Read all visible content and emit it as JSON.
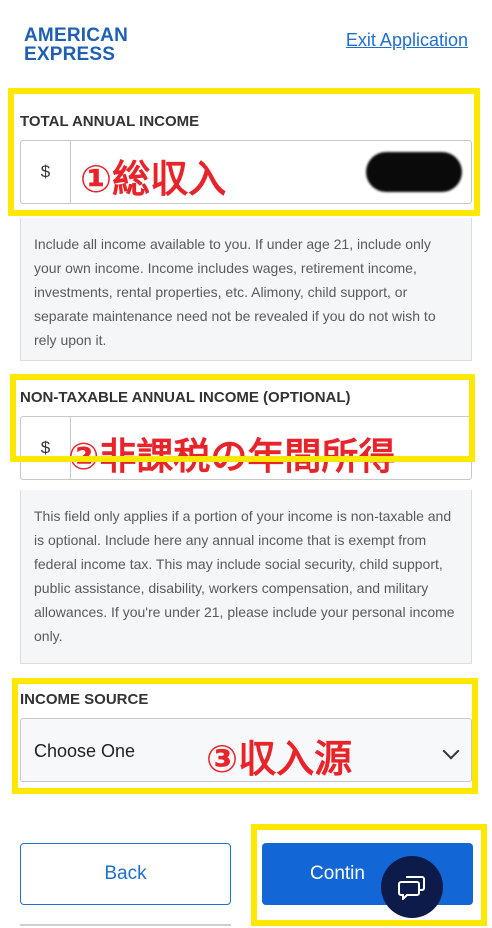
{
  "header": {
    "logo_line1": "AMERICAN",
    "logo_line2": "EXPRESS",
    "exit_label": "Exit Application"
  },
  "total_income": {
    "label": "TOTAL ANNUAL INCOME",
    "currency": "$",
    "annotation": "①総収入",
    "help": "Include all income available to you. If under age 21, include only your own income. Income includes wages, retirement income, investments, rental properties, etc. Alimony, child support, or separate maintenance need not be revealed if you do not wish to rely upon it."
  },
  "nontaxable_income": {
    "label": "NON-TAXABLE ANNUAL INCOME (OPTIONAL)",
    "currency": "$",
    "annotation": "②非課税の年間所得",
    "help": "This field only applies if a portion of your income is non-taxable and is optional. Include here any annual income that is exempt from federal income tax. This may include social security, child support, public assistance, disability, workers compensation, and military allowances. If you're under 21, please include your personal income only."
  },
  "income_source": {
    "label": "INCOME SOURCE",
    "selected": "Choose One",
    "annotation": "③収入源"
  },
  "footer": {
    "back_label": "Back",
    "continue_label": "Contin"
  },
  "colors": {
    "brand_blue": "#1f5fb6",
    "button_blue": "#1366d6",
    "highlight_yellow": "#ffe800",
    "annotation_red": "#e8232a",
    "chat_navy": "#0d1b4a"
  },
  "icons": {
    "select": "chevron-down-icon",
    "chat": "chat-bubble-icon"
  }
}
